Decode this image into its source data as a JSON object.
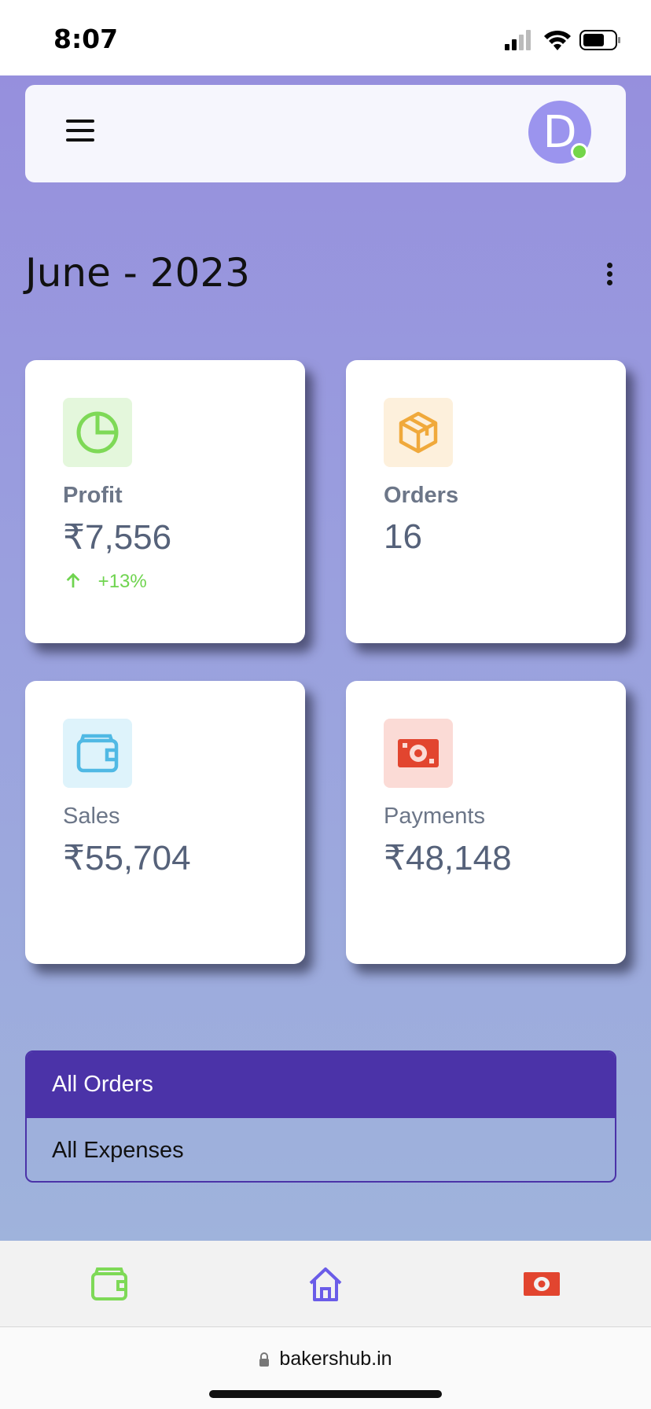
{
  "status_bar": {
    "time": "8:07"
  },
  "header": {
    "avatar_initial": "D"
  },
  "period": {
    "title": "June - 2023"
  },
  "cards": {
    "profit": {
      "label": "Profit",
      "value": "₹7,556",
      "change": "+13%",
      "icon": "pie-chart-icon",
      "icon_color": "#7ed957",
      "icon_bg": "#e4f7dc"
    },
    "orders": {
      "label": "Orders",
      "value": "16",
      "icon": "box-icon",
      "icon_color": "#f0a93b",
      "icon_bg": "#fdf0dc"
    },
    "sales": {
      "label": "Sales",
      "value": "₹55,704",
      "icon": "wallet-icon",
      "icon_color": "#50b9e4",
      "icon_bg": "#def3fb"
    },
    "payments": {
      "label": "Payments",
      "value": "₹48,148",
      "icon": "cash-icon",
      "icon_color": "#e2452f",
      "icon_bg": "#fbdbd6"
    }
  },
  "list": {
    "items": [
      "All Orders",
      "All Expenses"
    ],
    "active_index": 0
  },
  "bottom_nav": {
    "items": [
      "wallet-icon",
      "home-icon",
      "cash-icon"
    ]
  },
  "browser": {
    "url": "bakershub.in"
  },
  "colors": {
    "primary": "#4b33a8",
    "positive": "#6fd44f"
  }
}
